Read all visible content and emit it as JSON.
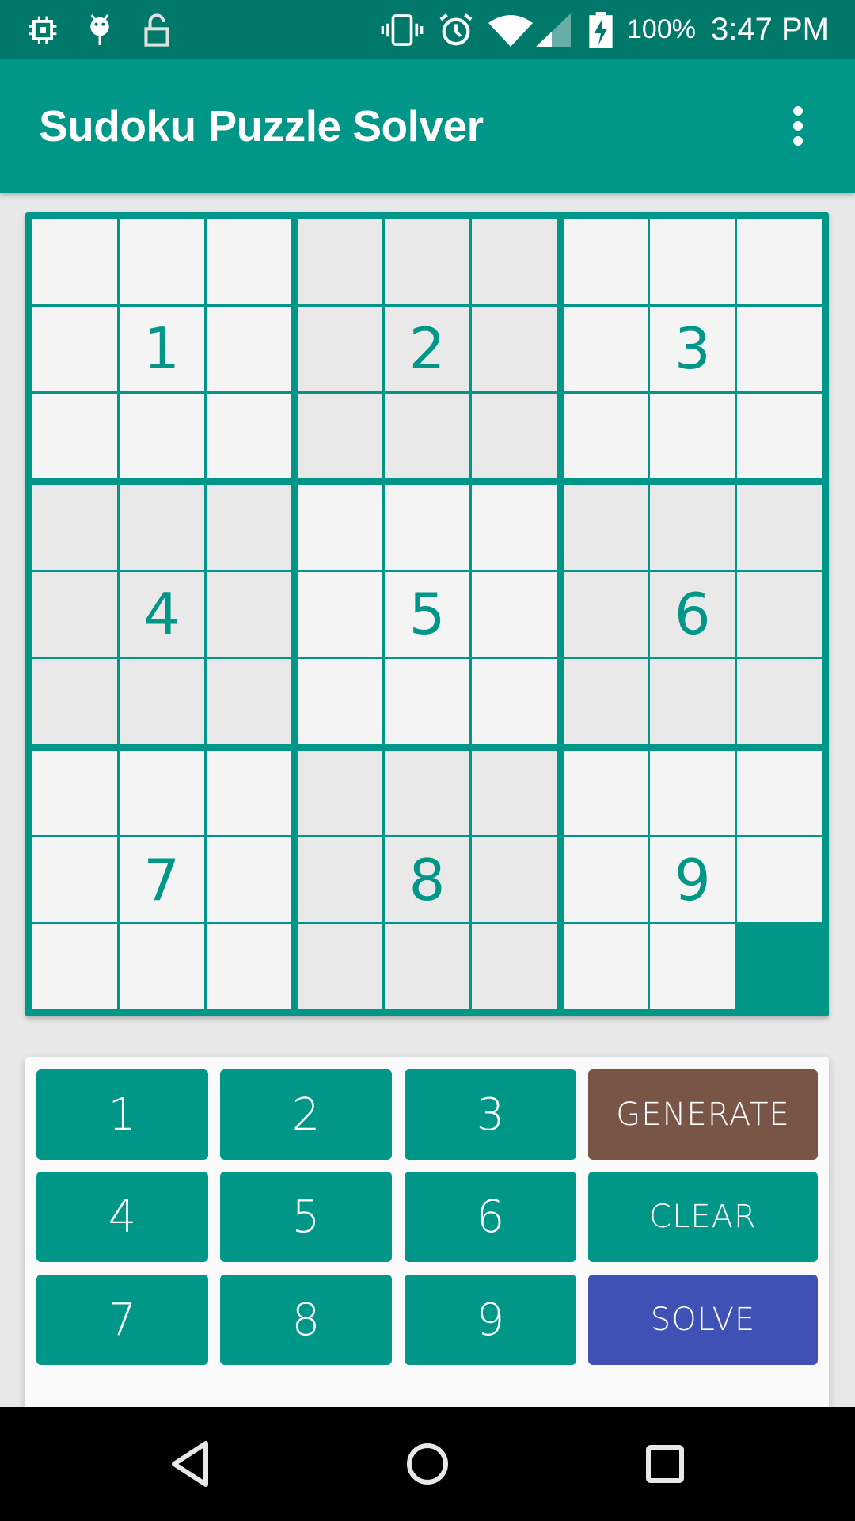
{
  "status_bar": {
    "left_icons": [
      "cpu-chip-icon",
      "android-debug-icon",
      "unlock-icon"
    ],
    "right_icons": [
      "vibrate-icon",
      "alarm-icon",
      "wifi-icon",
      "cell-signal-icon",
      "battery-charging-icon"
    ],
    "battery": "100%",
    "time": "3:47 PM"
  },
  "app_bar": {
    "title": "Sudoku Puzzle Solver",
    "menu_icon": "more-vert-icon"
  },
  "board": {
    "rows": [
      [
        "",
        "",
        "",
        "",
        "",
        "",
        "",
        "",
        ""
      ],
      [
        "",
        "1",
        "",
        "",
        "2",
        "",
        "",
        "3",
        ""
      ],
      [
        "",
        "",
        "",
        "",
        "",
        "",
        "",
        "",
        ""
      ],
      [
        "",
        "",
        "",
        "",
        "",
        "",
        "",
        "",
        ""
      ],
      [
        "",
        "4",
        "",
        "",
        "5",
        "",
        "",
        "6",
        ""
      ],
      [
        "",
        "",
        "",
        "",
        "",
        "",
        "",
        "",
        ""
      ],
      [
        "",
        "",
        "",
        "",
        "",
        "",
        "",
        "",
        ""
      ],
      [
        "",
        "7",
        "",
        "",
        "8",
        "",
        "",
        "9",
        ""
      ],
      [
        "",
        "",
        "",
        "",
        "",
        "",
        "",
        "",
        ""
      ]
    ],
    "selected_cell": {
      "row": 8,
      "col": 8
    },
    "shaded_boxes": [
      1,
      3,
      5,
      7
    ],
    "colors": {
      "accent": "#009688",
      "cell_light": "#f4f4f5",
      "cell_shaded": "#e9e9ea",
      "selected_text": "#ffffff"
    }
  },
  "keypad": {
    "numbers": [
      "1",
      "2",
      "3",
      "4",
      "5",
      "6",
      "7",
      "8",
      "9"
    ],
    "actions": [
      {
        "label": "GENERATE",
        "color": "#795548"
      },
      {
        "label": "CLEAR",
        "color": "#009688"
      },
      {
        "label": "SOLVE",
        "color": "#3f51b5"
      }
    ]
  },
  "nav_bar": {
    "buttons": [
      "back-icon",
      "home-icon",
      "recents-icon"
    ]
  }
}
